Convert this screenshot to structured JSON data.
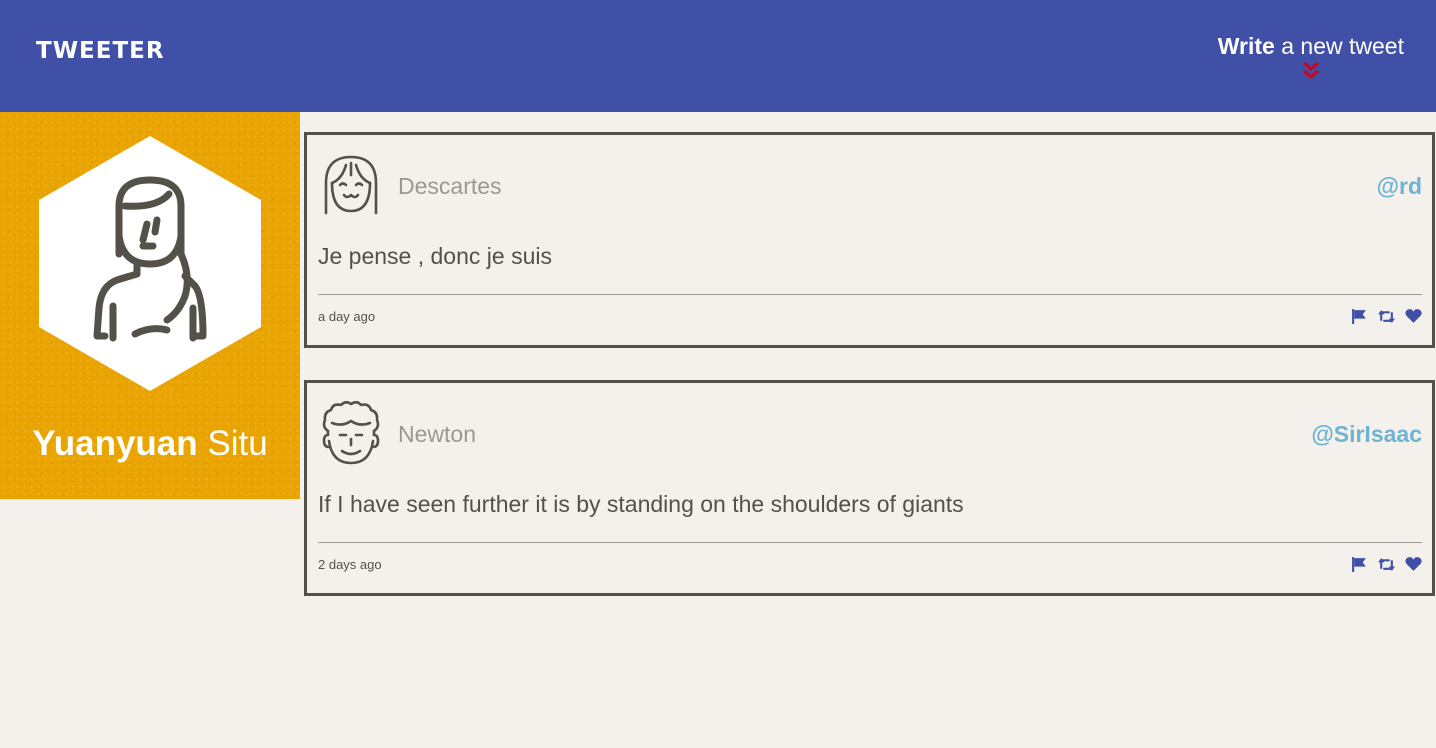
{
  "nav": {
    "logo": "TWEETER",
    "compose_strong": "Write",
    "compose_rest": "a new tweet",
    "compose_icon": "double-chevron-down-icon"
  },
  "profile": {
    "first_name": "Yuanyuan",
    "last_name": "Situ",
    "avatar_icon": "woman-avatar-icon"
  },
  "tweets": [
    {
      "name": "Descartes",
      "handle": "@rd",
      "text": "Je pense , donc je suis",
      "time": "a day ago",
      "avatar_icon": "smiling-girl-avatar-icon"
    },
    {
      "name": "Newton",
      "handle": "@SirIsaac",
      "text": "If I have seen further it is by standing on the shoulders of giants",
      "time": "2 days ago",
      "avatar_icon": "curly-hair-man-avatar-icon"
    }
  ],
  "colors": {
    "nav": "#4150a7",
    "profile": "#eaa401",
    "page": "#f4f1ec",
    "handle": "#6fb3d2",
    "action": "#4150a7",
    "chevron": "#d0021b"
  }
}
